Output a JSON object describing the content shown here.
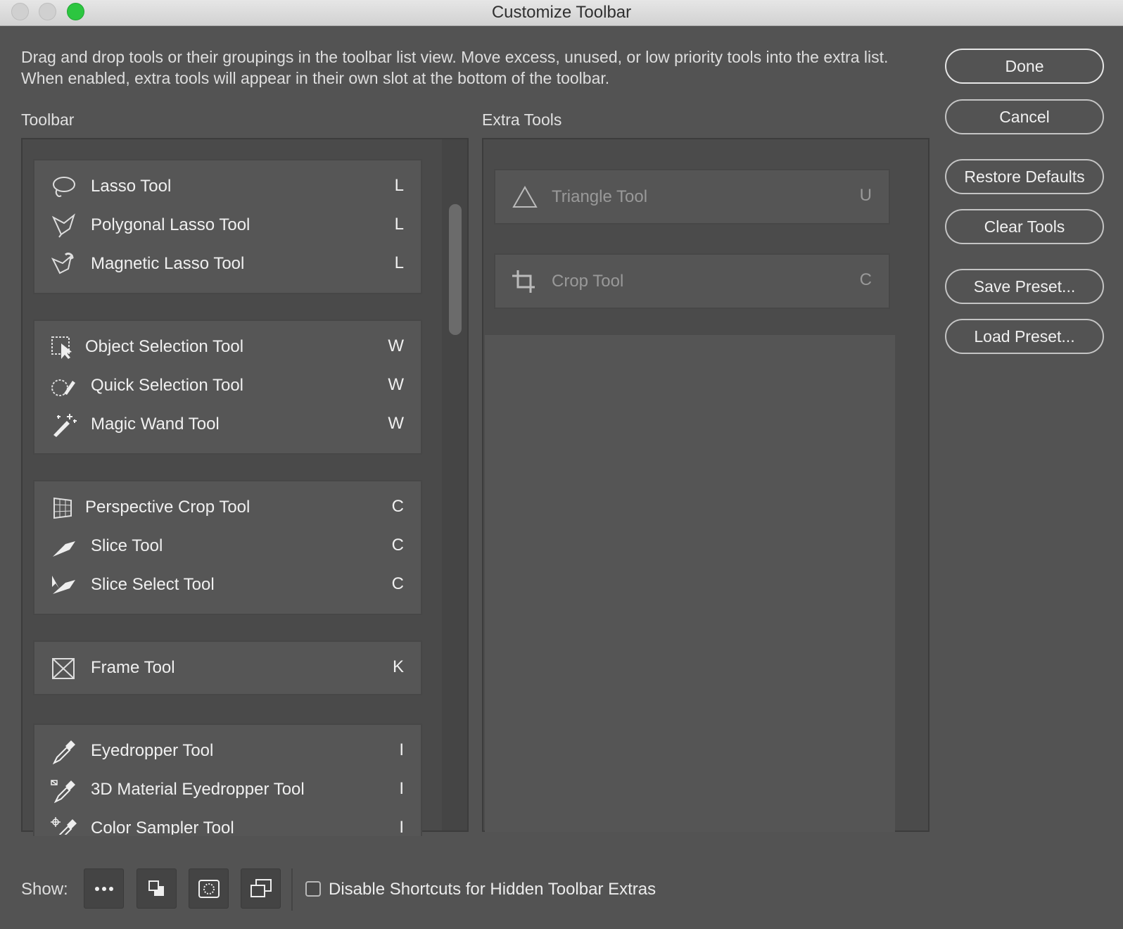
{
  "window": {
    "title": "Customize Toolbar"
  },
  "description": "Drag and drop tools or their groupings in the toolbar list view. Move excess, unused, or low priority tools into the extra list. When enabled, extra tools will appear in their own slot at the bottom of the toolbar.",
  "buttons": {
    "done": "Done",
    "cancel": "Cancel",
    "restore_defaults": "Restore Defaults",
    "clear_tools": "Clear Tools",
    "save_preset": "Save Preset...",
    "load_preset": "Load Preset..."
  },
  "toolbar": {
    "label": "Toolbar",
    "groups": [
      {
        "tools": [
          {
            "name": "Lasso Tool",
            "key": "L",
            "icon": "lasso-icon"
          },
          {
            "name": "Polygonal Lasso Tool",
            "key": "L",
            "icon": "polygonal-lasso-icon"
          },
          {
            "name": "Magnetic Lasso Tool",
            "key": "L",
            "icon": "magnetic-lasso-icon"
          }
        ]
      },
      {
        "tools": [
          {
            "name": "Object Selection Tool",
            "key": "W",
            "icon": "object-selection-icon"
          },
          {
            "name": "Quick Selection Tool",
            "key": "W",
            "icon": "quick-selection-icon"
          },
          {
            "name": "Magic Wand Tool",
            "key": "W",
            "icon": "magic-wand-icon"
          }
        ]
      },
      {
        "tools": [
          {
            "name": "Perspective Crop Tool",
            "key": "C",
            "icon": "perspective-crop-icon"
          },
          {
            "name": "Slice Tool",
            "key": "C",
            "icon": "slice-icon"
          },
          {
            "name": "Slice Select Tool",
            "key": "C",
            "icon": "slice-select-icon"
          }
        ]
      },
      {
        "tools": [
          {
            "name": "Frame Tool",
            "key": "K",
            "icon": "frame-icon"
          }
        ]
      },
      {
        "tools": [
          {
            "name": "Eyedropper Tool",
            "key": "I",
            "icon": "eyedropper-icon"
          },
          {
            "name": "3D Material Eyedropper Tool",
            "key": "I",
            "icon": "3d-material-eyedropper-icon"
          },
          {
            "name": "Color Sampler Tool",
            "key": "I",
            "icon": "color-sampler-icon"
          }
        ]
      }
    ]
  },
  "extra_tools": {
    "label": "Extra Tools",
    "tools": [
      {
        "name": "Triangle Tool",
        "key": "U",
        "icon": "triangle-icon"
      },
      {
        "name": "Crop Tool",
        "key": "C",
        "icon": "crop-icon"
      }
    ]
  },
  "bottom": {
    "show_label": "Show:",
    "show_buttons": [
      "more-icon",
      "foreground-background-icon",
      "quick-mask-icon",
      "screen-mode-icon"
    ],
    "checkbox_label": "Disable Shortcuts for Hidden Toolbar Extras",
    "checkbox_checked": false
  },
  "colors": {
    "background": "#535353",
    "zoom_button": "#2cc640"
  }
}
